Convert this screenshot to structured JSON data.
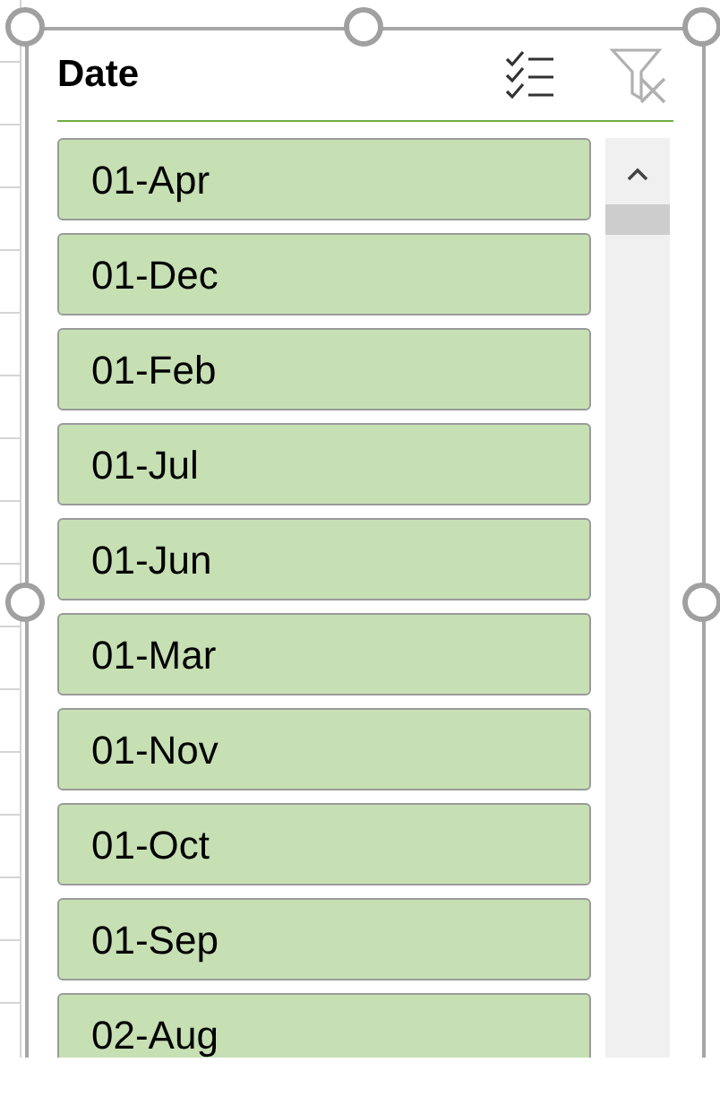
{
  "slicer": {
    "title": "Date",
    "items": [
      {
        "label": "01-Apr",
        "selected": true
      },
      {
        "label": "01-Dec",
        "selected": true
      },
      {
        "label": "01-Feb",
        "selected": true
      },
      {
        "label": "01-Jul",
        "selected": true
      },
      {
        "label": "01-Jun",
        "selected": true
      },
      {
        "label": "01-Mar",
        "selected": true
      },
      {
        "label": "01-Nov",
        "selected": true
      },
      {
        "label": "01-Oct",
        "selected": true
      },
      {
        "label": "01-Sep",
        "selected": true
      },
      {
        "label": "02-Aug",
        "selected": true
      }
    ]
  }
}
